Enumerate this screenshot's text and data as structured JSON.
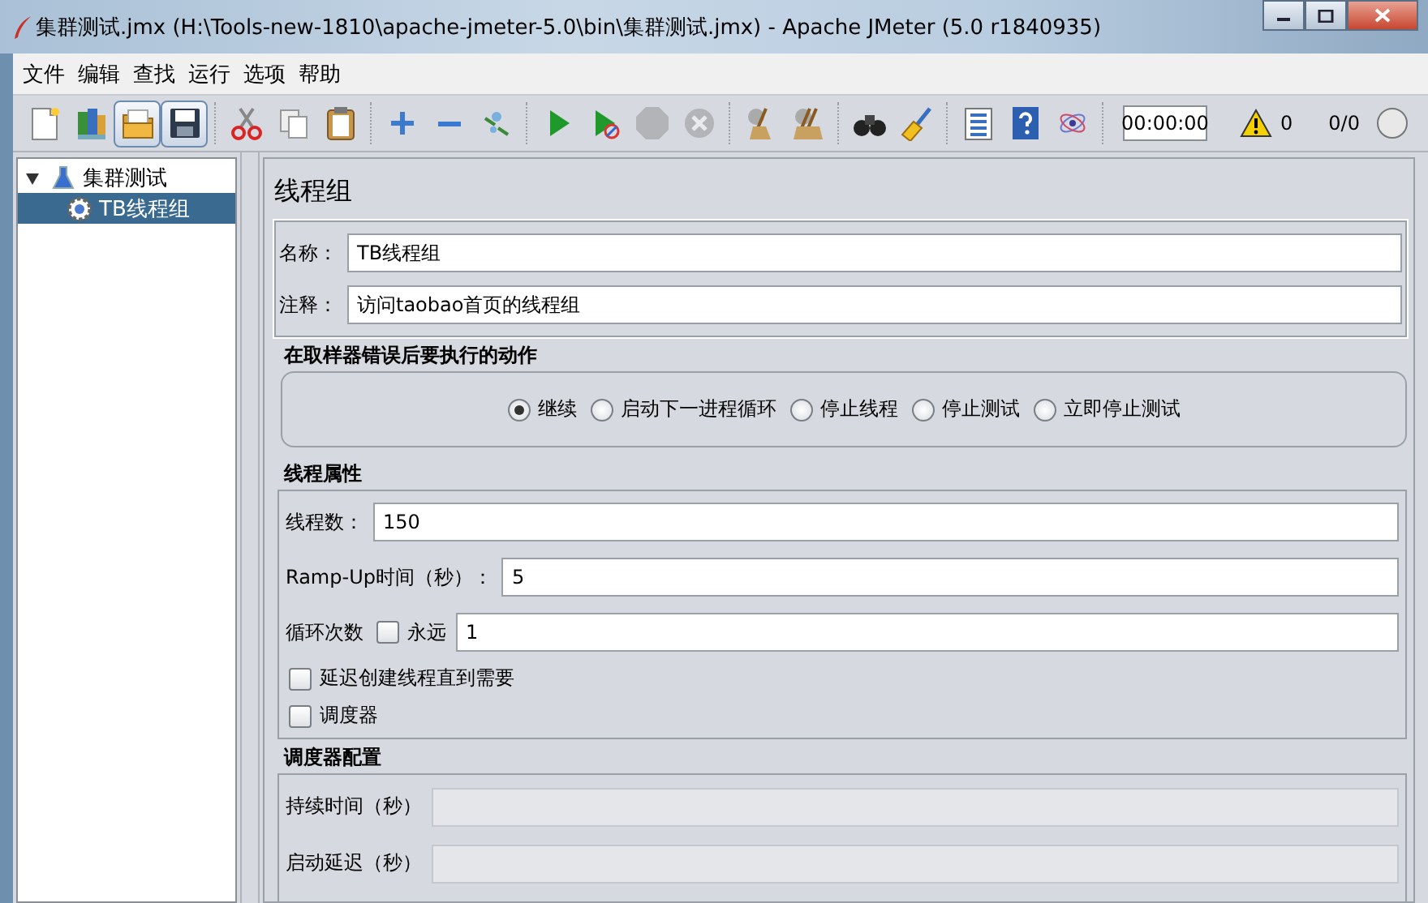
{
  "window": {
    "title": "集群测试.jmx (H:\\Tools-new-1810\\apache-jmeter-5.0\\bin\\集群测试.jmx) - Apache JMeter (5.0 r1840935)"
  },
  "menu": [
    "文件",
    "编辑",
    "查找",
    "运行",
    "选项",
    "帮助"
  ],
  "toolbar": {
    "groups": [
      [
        {
          "kind": "new",
          "disabled": false,
          "highlighted": false
        },
        {
          "kind": "templates",
          "disabled": false,
          "highlighted": false
        },
        {
          "kind": "open",
          "disabled": false,
          "highlighted": true
        },
        {
          "kind": "save",
          "disabled": false,
          "highlighted": true
        }
      ],
      [
        {
          "kind": "cut",
          "disabled": false,
          "highlighted": false
        },
        {
          "kind": "copy",
          "disabled": false,
          "highlighted": false
        },
        {
          "kind": "paste",
          "disabled": false,
          "highlighted": false
        }
      ],
      [
        {
          "kind": "expand",
          "disabled": false,
          "highlighted": false
        },
        {
          "kind": "collapse",
          "disabled": false,
          "highlighted": false
        },
        {
          "kind": "toggle",
          "disabled": false,
          "highlighted": false
        }
      ],
      [
        {
          "kind": "start",
          "disabled": false,
          "highlighted": false
        },
        {
          "kind": "start_no_pause",
          "disabled": false,
          "highlighted": false
        },
        {
          "kind": "stop",
          "disabled": true,
          "highlighted": false
        },
        {
          "kind": "shutdown",
          "disabled": true,
          "highlighted": false
        }
      ],
      [
        {
          "kind": "clear",
          "disabled": false,
          "highlighted": false
        },
        {
          "kind": "clear_all",
          "disabled": false,
          "highlighted": false
        }
      ],
      [
        {
          "kind": "search",
          "disabled": false,
          "highlighted": false
        },
        {
          "kind": "reset_search",
          "disabled": false,
          "highlighted": false
        }
      ],
      [
        {
          "kind": "functions",
          "disabled": false,
          "highlighted": false
        },
        {
          "kind": "help",
          "disabled": false,
          "highlighted": false
        },
        {
          "kind": "logger",
          "disabled": false,
          "highlighted": false
        }
      ]
    ],
    "timer": "00:00:00",
    "warnings": "0",
    "threads": "0/0"
  },
  "tree": [
    {
      "label": "集群测试",
      "kind": "plan",
      "expanded": true,
      "selected": false,
      "children": [
        {
          "label": "TB线程组",
          "kind": "threadgroup",
          "selected": true
        }
      ]
    }
  ],
  "panel": {
    "title": "线程组",
    "name": {
      "label": "名称：",
      "value": "TB线程组"
    },
    "comment": {
      "label": "注释：",
      "value": "访问taobao首页的线程组"
    },
    "error_action": {
      "title": "在取样器错误后要执行的动作",
      "options": [
        {
          "label": "继续",
          "selected": true
        },
        {
          "label": "启动下一进程循环",
          "selected": false
        },
        {
          "label": "停止线程",
          "selected": false
        },
        {
          "label": "停止测试",
          "selected": false
        },
        {
          "label": "立即停止测试",
          "selected": false
        }
      ]
    },
    "thread_properties": {
      "title": "线程属性",
      "threads": {
        "label": "线程数：",
        "value": "150"
      },
      "rampup": {
        "label": "Ramp-Up时间（秒）：",
        "value": "5"
      },
      "loop": {
        "label": "循环次数",
        "forever": {
          "label": "永远",
          "checked": false
        },
        "value": "1"
      },
      "delay": {
        "label": "延迟创建线程直到需要",
        "checked": false
      },
      "scheduler": {
        "label": "调度器",
        "checked": false
      }
    },
    "scheduler_config": {
      "title": "调度器配置",
      "fields": [
        {
          "label": "持续时间（秒）",
          "disabled": true
        },
        {
          "label": "启动延迟（秒）",
          "disabled": true
        }
      ]
    }
  }
}
